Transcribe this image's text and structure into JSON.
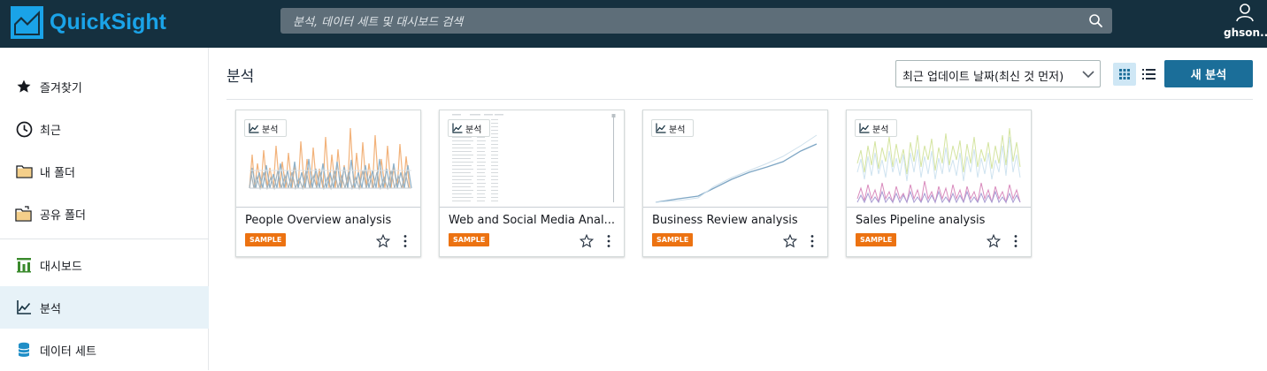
{
  "app": {
    "logo_text": "QuickSight",
    "brand_color": "#1aa3e8",
    "topbar_color": "#15303f"
  },
  "search": {
    "placeholder": "분석, 데이터 세트 및 대시보드 검색",
    "icon": "search-icon"
  },
  "user": {
    "name": "ghson...",
    "icon": "user-icon"
  },
  "sidebar": {
    "items": [
      {
        "label": "즐겨찾기",
        "icon": "star-icon",
        "active": false
      },
      {
        "label": "최근",
        "icon": "clock-icon",
        "active": false
      },
      {
        "label": "내 폴더",
        "icon": "folder-icon",
        "active": false
      },
      {
        "label": "공유 폴더",
        "icon": "shared-folder-icon",
        "active": false
      },
      {
        "label": "대시보드",
        "icon": "dashboard-icon",
        "active": false
      },
      {
        "label": "분석",
        "icon": "analysis-icon",
        "active": true
      },
      {
        "label": "데이터 세트",
        "icon": "database-icon",
        "active": false
      }
    ]
  },
  "main": {
    "title": "분석",
    "sort": {
      "selected": "최근 업데이트 날짜(최신 것 먼저)"
    },
    "view": {
      "grid_icon": "grid-view-icon",
      "list_icon": "list-view-icon",
      "selected": "grid"
    },
    "new_button": "새 분석",
    "cards": [
      {
        "type_label": "분석",
        "title": "People Overview analysis",
        "badge": "SAMPLE"
      },
      {
        "type_label": "분석",
        "title": "Web and Social Media Anal...",
        "badge": "SAMPLE"
      },
      {
        "type_label": "분석",
        "title": "Business Review analysis",
        "badge": "SAMPLE"
      },
      {
        "type_label": "분석",
        "title": "Sales Pipeline analysis",
        "badge": "SAMPLE"
      }
    ]
  },
  "colors": {
    "accent": "#1b6e99",
    "sample_badge": "#ec7211",
    "active_nav": "#e7f2f8"
  }
}
